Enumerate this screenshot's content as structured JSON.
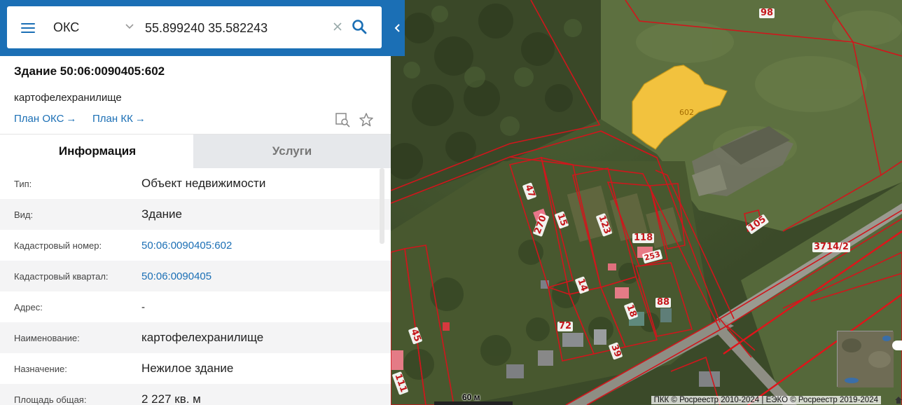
{
  "search": {
    "type_value": "ОКС",
    "query": "55.899240 35.582243"
  },
  "object": {
    "title": "Здание 50:06:0090405:602",
    "subtitle": "картофелехранилище",
    "links": [
      "План ОКС",
      "План КК"
    ],
    "link_arrow": "→"
  },
  "tabs": [
    {
      "label": "Информация",
      "active": true
    },
    {
      "label": "Услуги",
      "active": false
    }
  ],
  "info_rows": [
    {
      "label": "Тип:",
      "value": "Объект недвижимости"
    },
    {
      "label": "Вид:",
      "value": "Здание"
    },
    {
      "label": "Кадастровый номер:",
      "value": "50:06:0090405:602"
    },
    {
      "label": "Кадастровый квартал:",
      "value": "50:06:0090405"
    },
    {
      "label": "Адрес:",
      "value": "-"
    },
    {
      "label": "Наименование:",
      "value": "картофелехранилище"
    },
    {
      "label": "Назначение:",
      "value": "Нежилое здание"
    },
    {
      "label": "Площадь общая:",
      "value": "2 227 кв. м"
    }
  ],
  "map": {
    "building_label": "602",
    "parcel_labels": [
      "98",
      "47",
      "270",
      "15",
      "123",
      "118",
      "253",
      "105",
      "3714/2",
      "14",
      "18",
      "88",
      "72",
      "39",
      "45",
      "111"
    ],
    "scale": "60 м",
    "copyright": "ПКК © Росреестр 2010-2024 | ЕЭКО © Росреестр 2019-2024"
  },
  "colors": {
    "accent": "#1b6fb5",
    "parcel_border": "#d0161c",
    "building_fill": "#f2c23e"
  },
  "icons": [
    "menu-icon",
    "chevron-down-icon",
    "clear-icon",
    "search-icon",
    "plan-search-icon",
    "star-icon",
    "collapse-arrow-icon",
    "home-icon"
  ]
}
